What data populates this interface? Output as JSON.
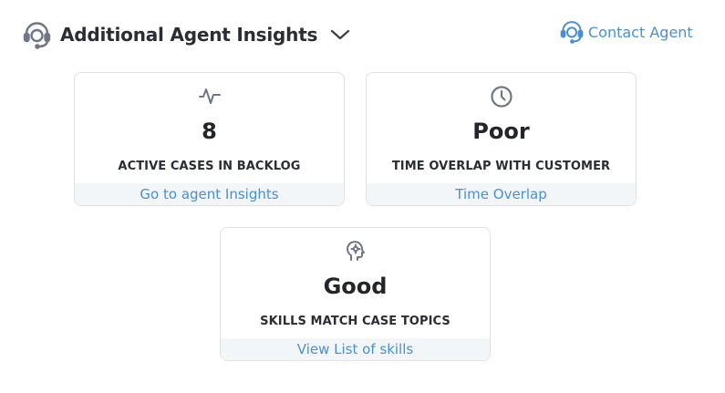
{
  "header": {
    "title": "Additional Agent Insights",
    "contact_label": "Contact Agent"
  },
  "colors": {
    "accent": "#4a8fd0",
    "icon_gray": "#6f7785",
    "card_border": "#dfe3e8",
    "link_background": "#f3f6f9"
  },
  "cards": [
    {
      "icon": "activity-pulse-icon",
      "value": "8",
      "label": "ACTIVE CASES IN BACKLOG",
      "link": "Go to agent Insights"
    },
    {
      "icon": "clock-icon",
      "value": "Poor",
      "label": "TIME OVERLAP WITH CUSTOMER",
      "link": "Time Overlap"
    },
    {
      "icon": "head-gear-icon",
      "value": "Good",
      "label": "SKILLS MATCH CASE TOPICS",
      "link": "View List of skills"
    }
  ]
}
